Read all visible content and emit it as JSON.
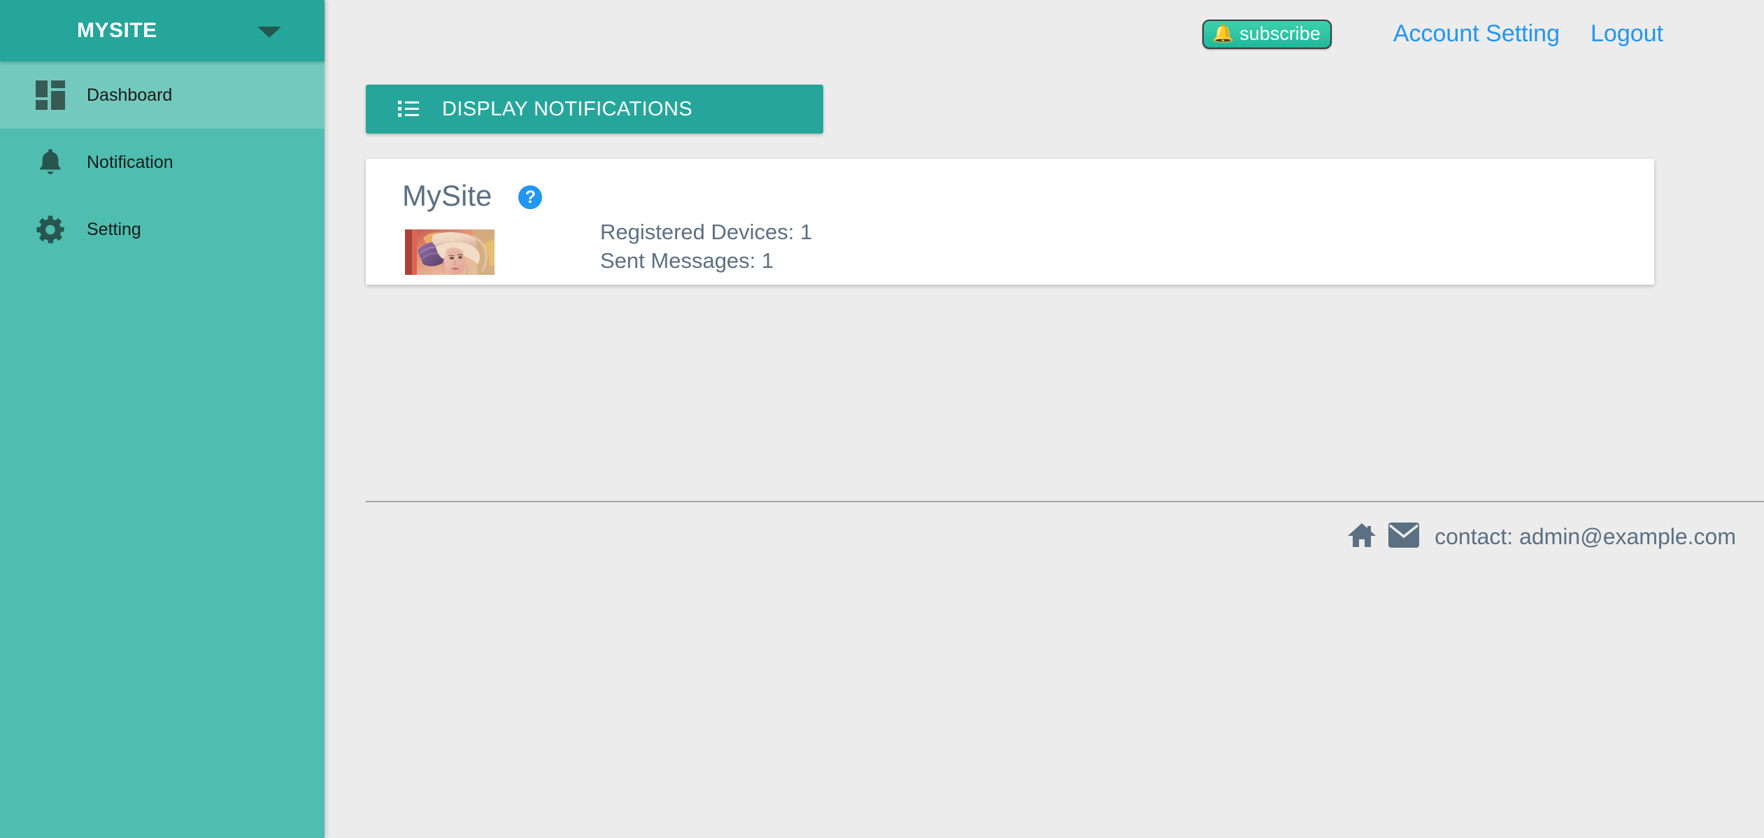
{
  "sidebar": {
    "brand": "MYSITE",
    "dropdown_icon": "chevron-down-icon",
    "items": [
      {
        "label": "Dashboard",
        "icon": "dashboard-grid-icon",
        "active": true
      },
      {
        "label": "Notification",
        "icon": "bell-icon",
        "active": false
      },
      {
        "label": "Setting",
        "icon": "gear-icon",
        "active": false
      }
    ]
  },
  "topbar": {
    "subscribe_label": "subscribe",
    "subscribe_icon": "bell-icon",
    "links": [
      {
        "label": "Account Setting"
      },
      {
        "label": "Logout"
      }
    ]
  },
  "main": {
    "display_notifications_label": "DISPLAY NOTIFICATIONS",
    "display_notifications_icon": "list-icon",
    "card": {
      "title": "MySite",
      "help_icon": "question-mark-icon",
      "help_glyph": "?",
      "thumbnail_alt": "site-thumbnail",
      "stats": [
        "Registered Devices: 1",
        "Sent Messages: 1"
      ]
    }
  },
  "footer": {
    "home_icon": "home-icon",
    "mail_icon": "envelope-icon",
    "contact_text": "contact: admin@example.com"
  },
  "colors": {
    "sidebar_bg": "#4fbdb0",
    "sidebar_header_bg": "#26a69a",
    "sidebar_active_bg": "#74c9bd",
    "accent_teal": "#26a69a",
    "link_blue": "#2196f3",
    "page_bg": "#ececec",
    "text_slate": "#5b7083",
    "icon_dark_teal": "#375a55",
    "bell_yellow": "#f7e27a"
  }
}
